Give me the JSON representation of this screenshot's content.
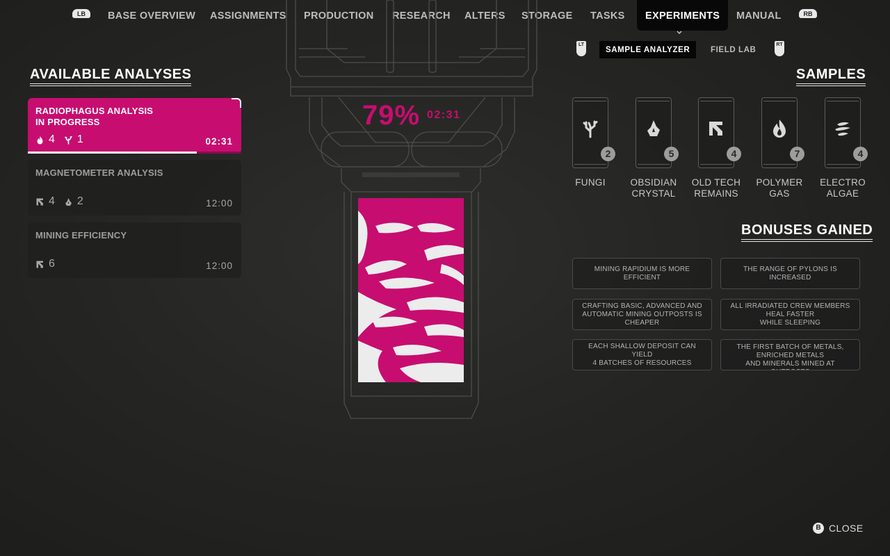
{
  "nav": {
    "left_bumper": "LB",
    "right_bumper": "RB",
    "items": [
      {
        "label": "BASE OVERVIEW"
      },
      {
        "label": "ASSIGNMENTS"
      },
      {
        "label": "PRODUCTION"
      },
      {
        "label": "RESEARCH"
      },
      {
        "label": "ALTERS"
      },
      {
        "label": "STORAGE"
      },
      {
        "label": "TASKS"
      },
      {
        "label": "EXPERIMENTS",
        "active": true
      },
      {
        "label": "MANUAL"
      }
    ]
  },
  "subtabs": {
    "left_trigger": "LT",
    "right_trigger": "RT",
    "items": [
      {
        "label": "SAMPLE ANALYZER",
        "active": true
      },
      {
        "label": "FIELD LAB"
      }
    ]
  },
  "analyses": {
    "heading": "AVAILABLE ANALYSES",
    "items": [
      {
        "title": "RADIOPHAGUS ANALYSIS\nIN PROGRESS",
        "time": "02:31",
        "progress": 0.79,
        "active": true,
        "requirements": [
          {
            "icon": "polymer-gas-icon",
            "count": "4"
          },
          {
            "icon": "fungi-icon",
            "count": "1"
          }
        ]
      },
      {
        "title": "MAGNETOMETER ANALYSIS",
        "time": "12:00",
        "requirements": [
          {
            "icon": "old-tech-icon",
            "count": "4"
          },
          {
            "icon": "obsidian-icon",
            "count": "2"
          }
        ]
      },
      {
        "title": "MINING EFFICIENCY",
        "time": "12:00",
        "requirements": [
          {
            "icon": "old-tech-icon",
            "count": "6"
          }
        ]
      }
    ]
  },
  "analyzer": {
    "percent": "79%",
    "time": "02:31",
    "accent_color": "#c70d6f"
  },
  "samples": {
    "heading": "SAMPLES",
    "items": [
      {
        "name": "FUNGI",
        "count": "2",
        "icon": "fungi-icon"
      },
      {
        "name": "OBSIDIAN\nCRYSTAL",
        "count": "5",
        "icon": "obsidian-icon"
      },
      {
        "name": "OLD TECH\nREMAINS",
        "count": "4",
        "icon": "old-tech-icon"
      },
      {
        "name": "POLYMER\nGAS",
        "count": "7",
        "icon": "polymer-gas-icon"
      },
      {
        "name": "ELECTRO\nALGAE",
        "count": "4",
        "icon": "electro-algae-icon"
      }
    ]
  },
  "bonuses": {
    "heading": "BONUSES GAINED",
    "items": [
      "MINING RAPIDIUM IS MORE\nEFFICIENT",
      "THE RANGE OF PYLONS IS\nINCREASED",
      "CRAFTING BASIC, ADVANCED AND\nAUTOMATIC MINING OUTPOSTS IS\nCHEAPER",
      "ALL IRRADIATED CREW MEMBERS\nHEAL FASTER\nWHILE SLEEPING",
      "EACH SHALLOW DEPOSIT CAN YIELD\n4 BATCHES OF RESOURCES",
      "THE FIRST BATCH OF METALS,\nENRICHED METALS\nAND MINERALS MINED AT OUTPOSTS\nON EACH DAY IS MORE ABUNDANT"
    ]
  },
  "close": {
    "button": "B",
    "label": "CLOSE"
  }
}
